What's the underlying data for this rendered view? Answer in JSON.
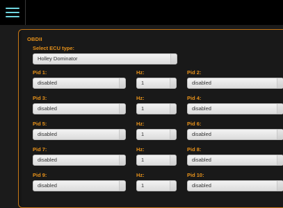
{
  "header": {
    "menu_icon": "hamburger-icon"
  },
  "panel": {
    "title": "OBDII",
    "ecu_label": "Select ECU type:",
    "ecu_value": "Holley Dominator",
    "rows": [
      {
        "pid_a": "Pid 1:",
        "pid_a_value": "disabled",
        "hz_label": "Hz:",
        "hz_value": "1",
        "pid_b": "Pid 2:",
        "pid_b_value": "disabled"
      },
      {
        "pid_a": "Pid 3:",
        "pid_a_value": "disabled",
        "hz_label": "Hz:",
        "hz_value": "1",
        "pid_b": "Pid 4:",
        "pid_b_value": "disabled"
      },
      {
        "pid_a": "Pid 5:",
        "pid_a_value": "disabled",
        "hz_label": "Hz:",
        "hz_value": "1",
        "pid_b": "Pid 6:",
        "pid_b_value": "disabled"
      },
      {
        "pid_a": "Pid 7:",
        "pid_a_value": "disabled",
        "hz_label": "Hz:",
        "hz_value": "1",
        "pid_b": "Pid 8:",
        "pid_b_value": "disabled"
      },
      {
        "pid_a": "Pid 9:",
        "pid_a_value": "disabled",
        "hz_label": "Hz:",
        "hz_value": "1",
        "pid_b": "Pid 10:",
        "pid_b_value": "disabled"
      }
    ]
  },
  "colors": {
    "accent": "#e8921a",
    "menu": "#6fd6e0",
    "background": "#1b1b1b"
  }
}
